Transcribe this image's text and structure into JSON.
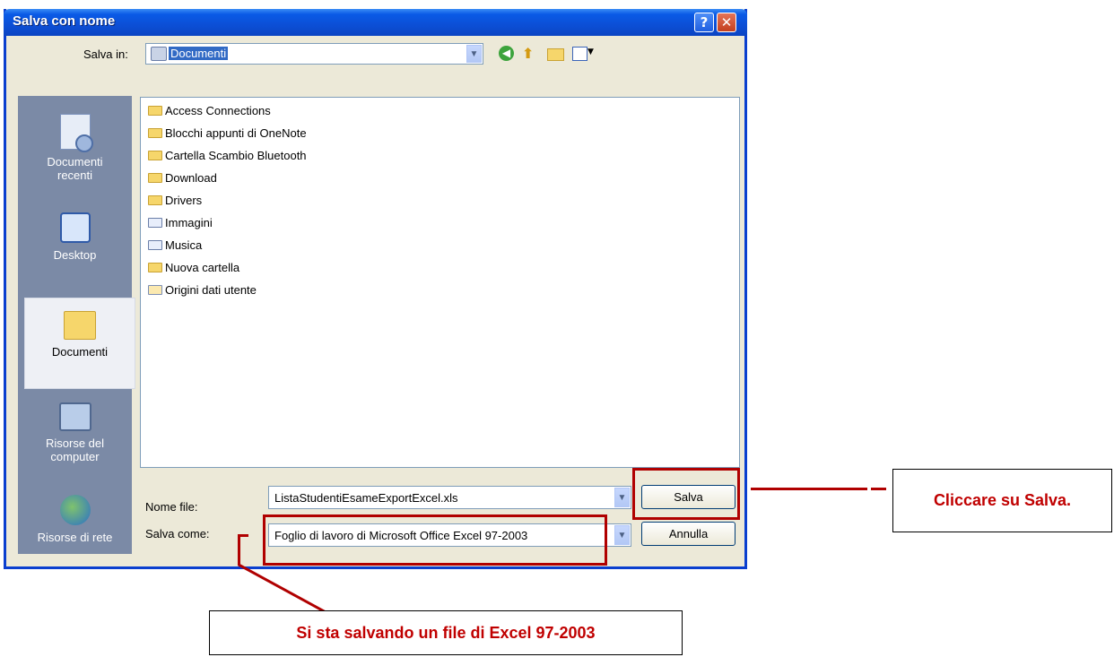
{
  "dialog": {
    "title": "Salva con nome",
    "help_glyph": "?",
    "close_glyph": "✕"
  },
  "toolbar": {
    "save_in_label": "Salva in:",
    "location": "Documenti",
    "icons": [
      "back-icon",
      "up-folder-icon",
      "new-folder-icon",
      "views-icon"
    ]
  },
  "places": [
    {
      "label": "Documenti recenti",
      "icon": "recent-documents-icon"
    },
    {
      "label": "Desktop",
      "icon": "desktop-icon"
    },
    {
      "label": "Documenti",
      "icon": "my-documents-icon",
      "selected": true
    },
    {
      "label": "Risorse del computer",
      "icon": "my-computer-icon"
    },
    {
      "label": "Risorse di rete",
      "icon": "network-icon"
    }
  ],
  "files": [
    {
      "name": "Access Connections",
      "icon": "folder-icon"
    },
    {
      "name": "Blocchi appunti di OneNote",
      "icon": "folder-icon"
    },
    {
      "name": "Cartella Scambio Bluetooth",
      "icon": "folder-icon"
    },
    {
      "name": "Download",
      "icon": "folder-icon"
    },
    {
      "name": "Drivers",
      "icon": "folder-icon"
    },
    {
      "name": "Immagini",
      "icon": "pictures-folder-icon"
    },
    {
      "name": "Musica",
      "icon": "music-folder-icon"
    },
    {
      "name": "Nuova cartella",
      "icon": "folder-icon"
    },
    {
      "name": "Origini dati utente",
      "icon": "data-sources-folder-icon"
    }
  ],
  "form": {
    "filename_label": "Nome file:",
    "filename_value": "ListaStudentiEsameExportExcel.xls",
    "filetype_label": "Salva come:",
    "filetype_value": "Foglio di lavoro di Microsoft Office Excel 97-2003",
    "save_button": "Salva",
    "cancel_button": "Annulla"
  },
  "annotations": {
    "save_callout": "Cliccare su Salva.",
    "type_callout": "Si sta salvando un file di Excel 97-2003",
    "color": "#b00000"
  }
}
